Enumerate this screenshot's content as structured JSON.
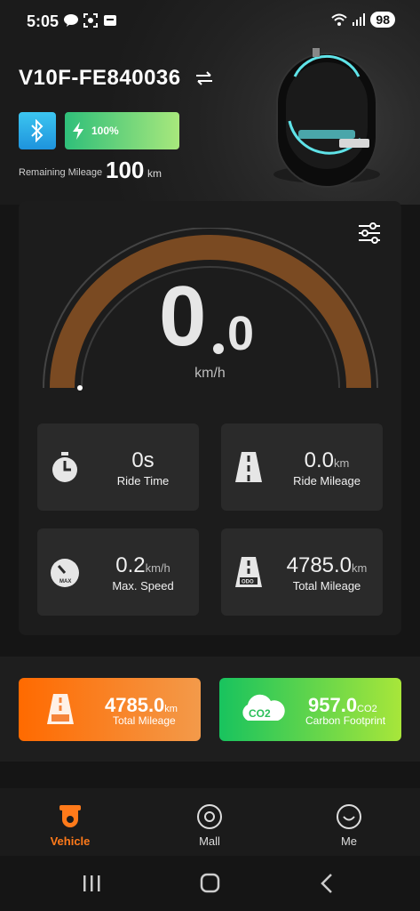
{
  "status": {
    "time": "5:05",
    "battery": "98"
  },
  "device": {
    "name": "V10F-FE840036",
    "battery_pct": "100%",
    "remaining_label": "Remaining Mileage",
    "remaining_value": "100",
    "remaining_unit": "km"
  },
  "speed": {
    "integer": "0",
    "decimal": "0",
    "unit": "km/h"
  },
  "stats": [
    {
      "value": "0s",
      "unit": "",
      "label": "Ride Time",
      "icon": "stopwatch-icon"
    },
    {
      "value": "0.0",
      "unit": "km",
      "label": "Ride Mileage",
      "icon": "road-icon"
    },
    {
      "value": "0.2",
      "unit": "km/h",
      "label": "Max. Speed",
      "icon": "speedometer-icon"
    },
    {
      "value": "4785.0",
      "unit": "km",
      "label": "Total Mileage",
      "icon": "odometer-road-icon"
    }
  ],
  "promos": {
    "mileage": {
      "value": "4785.0",
      "unit": "km",
      "label": "Total Mileage"
    },
    "carbon": {
      "value": "957.0",
      "unit": "CO2",
      "label": "Carbon Footprint"
    }
  },
  "tabs": [
    {
      "label": "Vehicle",
      "active": true
    },
    {
      "label": "Mall",
      "active": false
    },
    {
      "label": "Me",
      "active": false
    }
  ],
  "colors": {
    "accent": "#ff7a1a",
    "gauge_arc": "#7a4a22",
    "bluetooth": "#2aa8e8",
    "battery": "#5cd27a"
  }
}
